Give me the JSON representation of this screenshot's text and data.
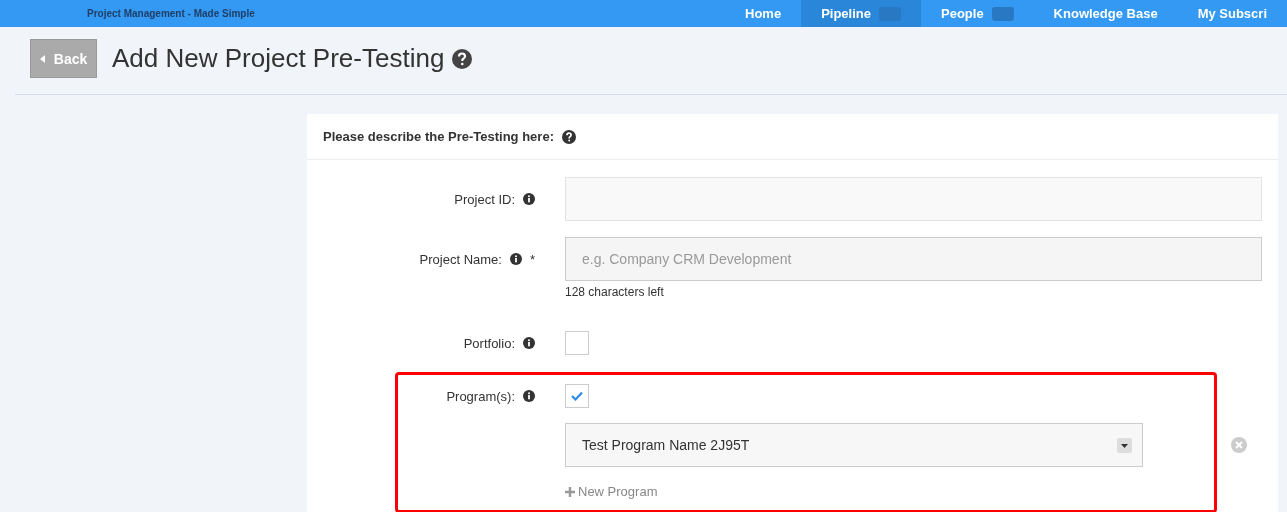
{
  "nav": {
    "subtitle": "Project Management - Made Simple",
    "items": [
      {
        "label": "Home",
        "selected": false,
        "badge": false
      },
      {
        "label": "Pipeline",
        "selected": true,
        "badge": true
      },
      {
        "label": "People",
        "selected": false,
        "badge": true
      },
      {
        "label": "Knowledge Base",
        "selected": false,
        "badge": false
      },
      {
        "label": "My Subscri",
        "selected": false,
        "badge": false
      }
    ]
  },
  "back_button": "Back",
  "title": "Add New Project Pre-Testing",
  "form": {
    "heading": "Please describe the Pre-Testing here:",
    "fields": [
      {
        "kind": "text",
        "label": "Project ID:",
        "info": true
      },
      {
        "kind": "text",
        "label": "Project Name:",
        "info": true,
        "required_mark": "*",
        "placeholder": "e.g. Company CRM Development",
        "hint": "128 characters left"
      },
      {
        "kind": "checkbox",
        "label": "Portfolio:",
        "info": true,
        "checked": false
      },
      {
        "kind": "checkbox",
        "label": "Program(s):",
        "info": true,
        "checked": true,
        "highlighted": true,
        "select": {
          "value": "Test Program Name 2J95T"
        },
        "add_link": "New Program"
      }
    ]
  }
}
